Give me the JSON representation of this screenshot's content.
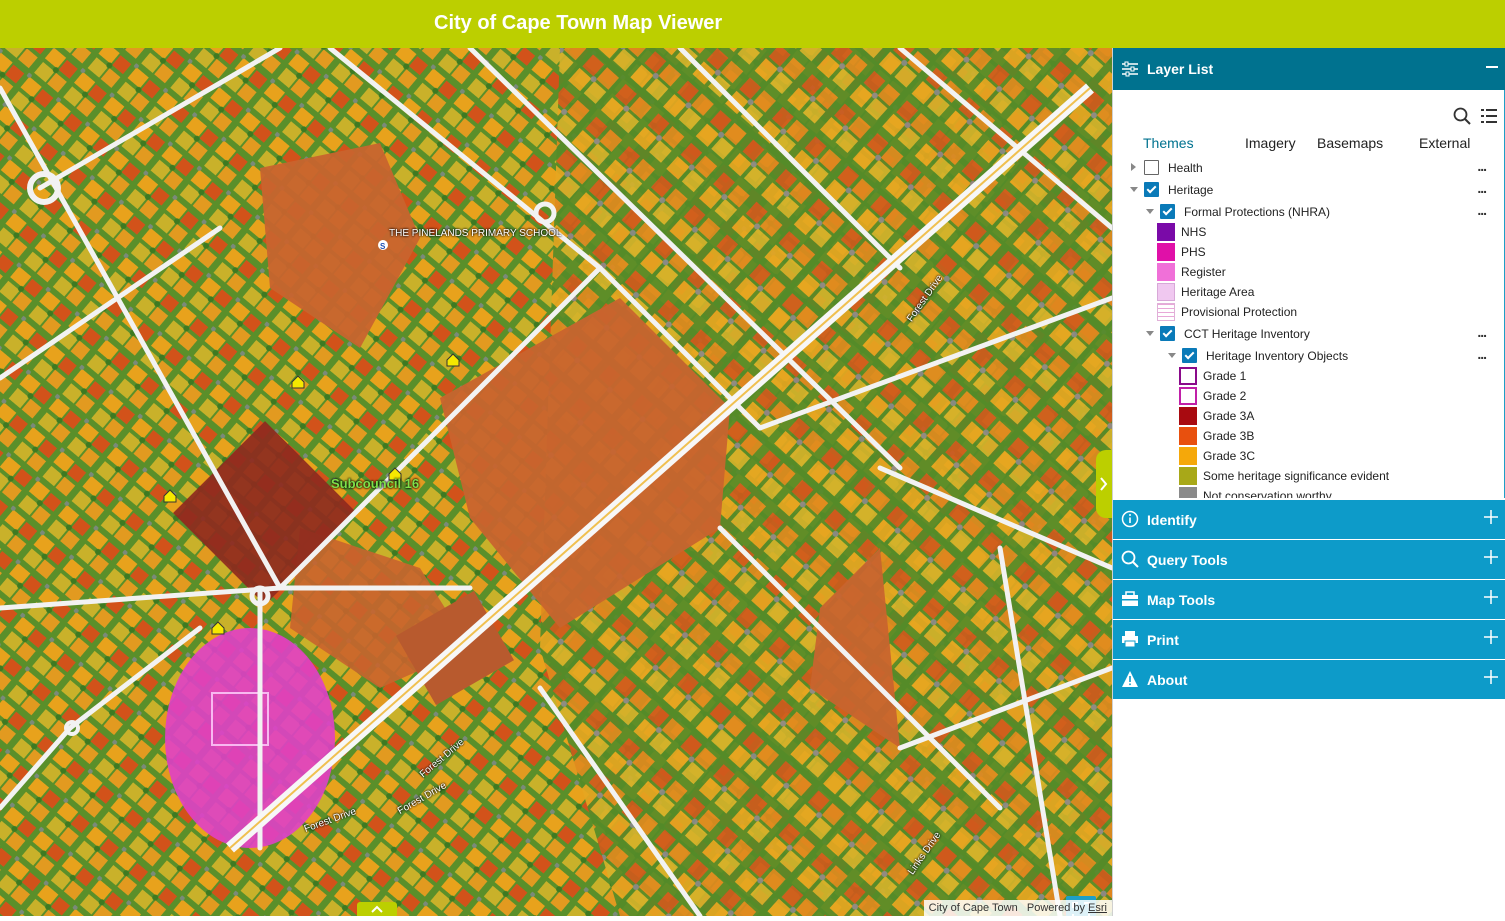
{
  "app": {
    "title": "City of Cape Town Map Viewer"
  },
  "map": {
    "labels": {
      "school": "THE PINELANDS PRIMARY SCHOOL",
      "subcouncil": "Subcouncil 16",
      "forest_drive": "Forest Drive",
      "links_drive": "Links Drive",
      "school_marker": "S"
    },
    "attribution": {
      "owner": "City of Cape Town",
      "powered_by": "Powered by",
      "esri": "Esri"
    },
    "colors": {
      "vegetation": "#6aa82c",
      "grade_3c": "#e8a21c",
      "grade_3b": "#d2521a",
      "grade_3a": "#a41414",
      "register": "#e040c8",
      "field": "#c8642e",
      "road": "#f2f2f2"
    }
  },
  "panel": {
    "layer_list": {
      "title": "Layer List",
      "tabs": [
        {
          "label": "Themes",
          "active": true
        },
        {
          "label": "Imagery",
          "active": false
        },
        {
          "label": "Basemaps",
          "active": false
        },
        {
          "label": "External",
          "active": false
        }
      ],
      "rows": {
        "health": "Health",
        "heritage": "Heritage",
        "formal_protections": "Formal Protections (NHRA)",
        "nhs": "NHS",
        "phs": "PHS",
        "register": "Register",
        "heritage_area": "Heritage Area",
        "provisional": "Provisional Protection",
        "cct_inventory": "CCT Heritage Inventory",
        "inventory_objects": "Heritage Inventory Objects",
        "grade1": "Grade 1",
        "grade2": "Grade 2",
        "grade3a": "Grade 3A",
        "grade3b": "Grade 3B",
        "grade3c": "Grade 3C",
        "some_significance": "Some heritage significance evident",
        "not_worthy": "Not conservation worthy"
      },
      "more_glyph": "..."
    },
    "accordions": [
      {
        "label": "Identify",
        "icon": "info-icon"
      },
      {
        "label": "Query Tools",
        "icon": "search-icon"
      },
      {
        "label": "Map Tools",
        "icon": "toolbox-icon"
      },
      {
        "label": "Print",
        "icon": "printer-icon"
      },
      {
        "label": "About",
        "icon": "warning-icon"
      }
    ]
  }
}
